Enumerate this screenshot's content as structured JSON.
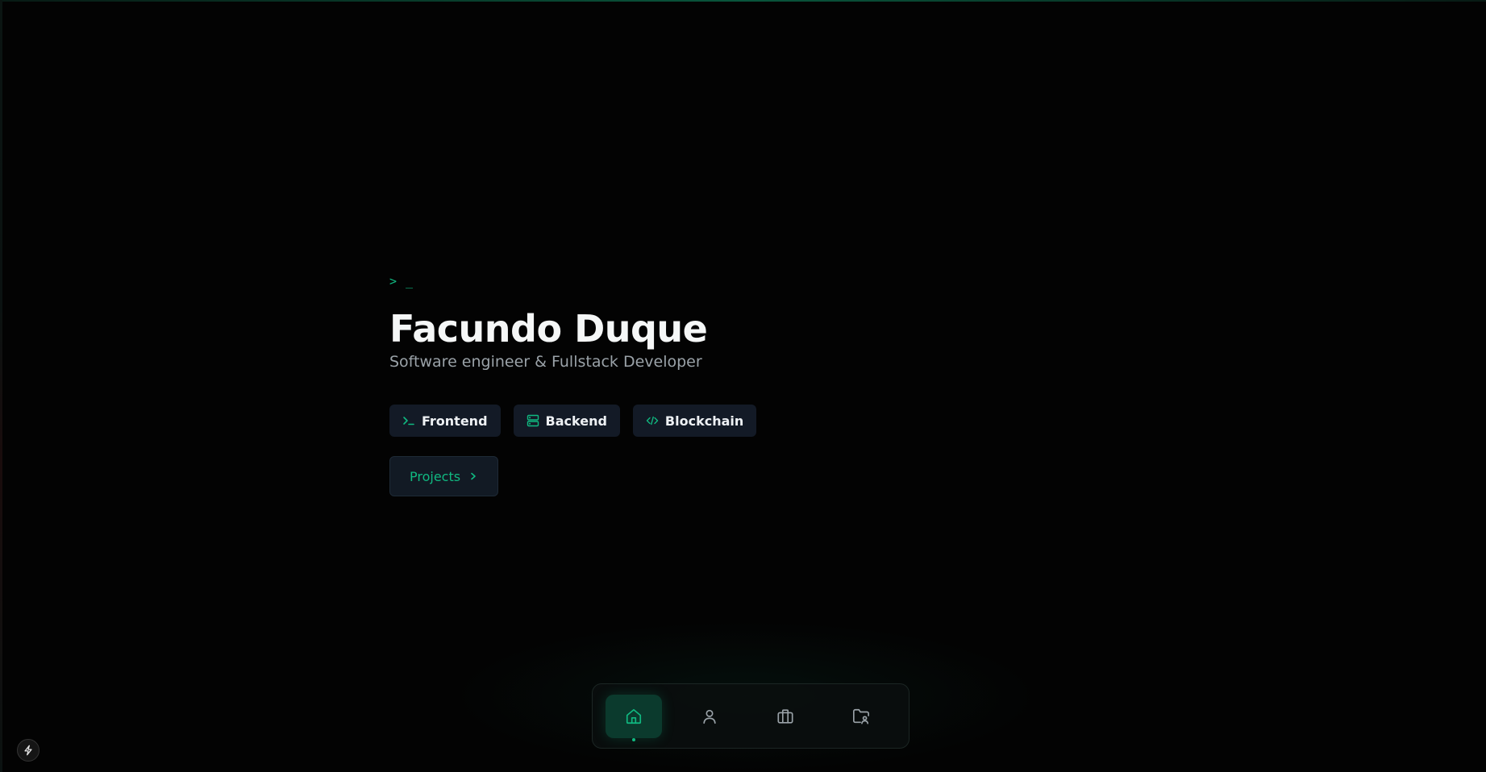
{
  "hero": {
    "prompt": "> _",
    "name": "Facundo Duque",
    "subtitle": "Software engineer & Fullstack Developer"
  },
  "chips": [
    {
      "label": "Frontend",
      "icon": "terminal-icon"
    },
    {
      "label": "Backend",
      "icon": "server-icon"
    },
    {
      "label": "Blockchain",
      "icon": "code-icon"
    }
  ],
  "projects_button": {
    "label": "Projects",
    "icon": "chevron-right-icon"
  },
  "dock": {
    "items": [
      {
        "icon": "home-icon",
        "active": true
      },
      {
        "icon": "user-icon",
        "active": false
      },
      {
        "icon": "briefcase-icon",
        "active": false
      },
      {
        "icon": "folder-user-icon",
        "active": false
      }
    ]
  },
  "corner_badge": {
    "icon": "lightning-bolt-icon"
  },
  "colors": {
    "accent": "#10b981",
    "background": "#030303",
    "chip_bg": "#131a26",
    "subtitle": "#9aa2a8"
  }
}
